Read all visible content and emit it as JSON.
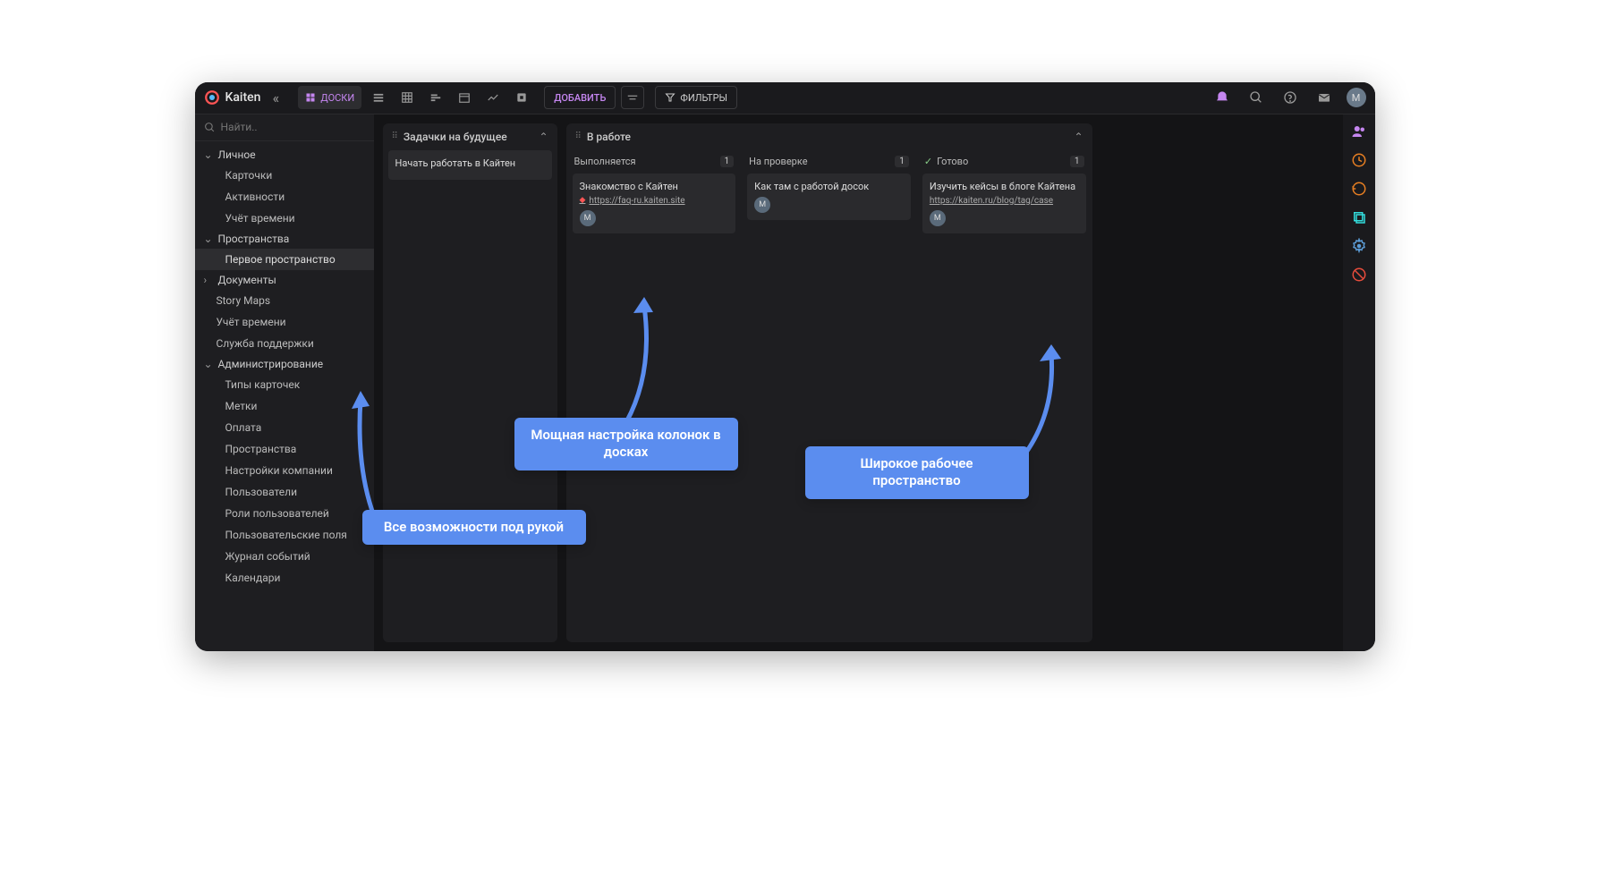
{
  "app_name": "Kaiten",
  "search_placeholder": "Найти..",
  "toolbar": {
    "boards_label": "ДОСКИ",
    "add_label": "ДОБАВИТЬ",
    "filters_label": "ФИЛЬТРЫ"
  },
  "avatar_letter": "M",
  "sidebar": {
    "personal": {
      "label": "Личное",
      "items": [
        "Карточки",
        "Активности",
        "Учёт времени"
      ]
    },
    "spaces": {
      "label": "Пространства",
      "items": [
        "Первое пространство"
      ]
    },
    "documents": {
      "label": "Документы"
    },
    "story_maps": "Story Maps",
    "time_tracking": "Учёт времени",
    "support": "Служба поддержки",
    "admin": {
      "label": "Администрирование",
      "items": [
        "Типы карточек",
        "Метки",
        "Оплата",
        "Пространства",
        "Настройки компании",
        "Пользователи",
        "Роли пользователей",
        "Пользовательские поля",
        "Журнал событий",
        "Календари"
      ]
    }
  },
  "boards": [
    {
      "title": "Задачки на будущее",
      "cards": [
        {
          "title": "Начать работать в Кайтен"
        }
      ]
    },
    {
      "title": "В работе",
      "columns": [
        {
          "title": "Выполняется",
          "count": "1",
          "cards": [
            {
              "title": "Знакомство с Кайтен",
              "link": "https://faq-ru.kaiten.site",
              "avatar": "M",
              "diamond": true
            }
          ]
        },
        {
          "title": "На проверке",
          "count": "1",
          "cards": [
            {
              "title": "Как там с работой досок",
              "avatar": "M"
            }
          ]
        },
        {
          "title": "Готово",
          "count": "1",
          "done": true,
          "cards": [
            {
              "title": "Изучить кейсы в блоге Кайтена",
              "link": "https://kaiten.ru/blog/tag/case",
              "avatar": "M"
            }
          ]
        }
      ]
    }
  ],
  "callouts": {
    "left": "Все возможности под рукой",
    "center": "Мощная настройка колонок в досках",
    "right": "Широкое рабочее пространство"
  }
}
